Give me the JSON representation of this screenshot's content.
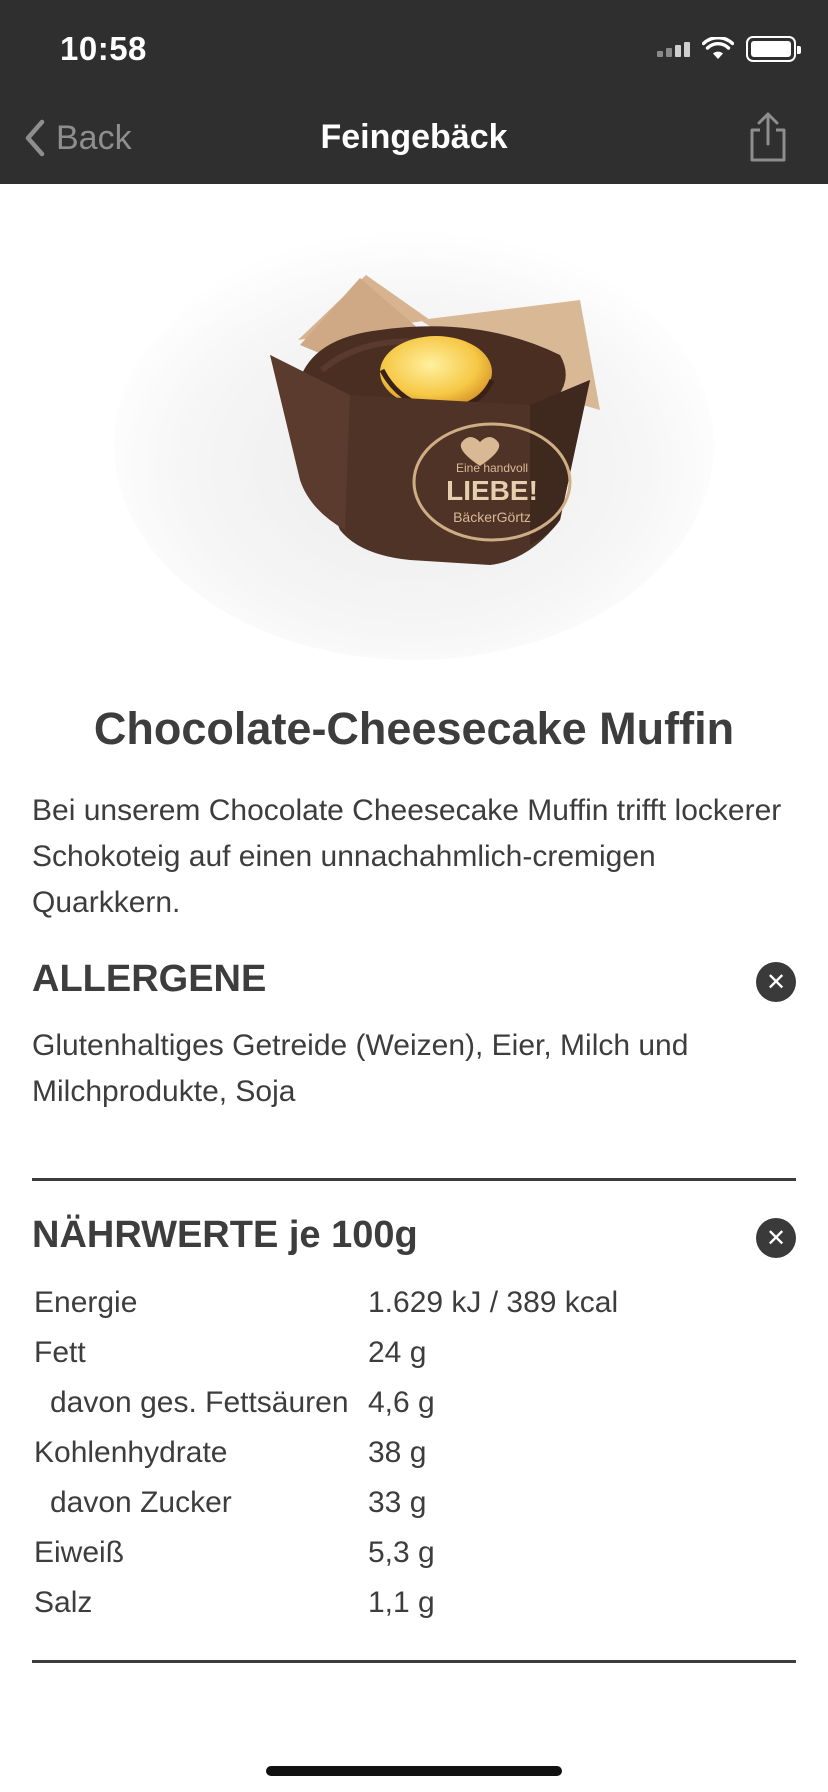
{
  "status_bar": {
    "time": "10:58"
  },
  "nav": {
    "back_label": "Back",
    "title": "Feingebäck"
  },
  "product": {
    "title": "Chocolate-Cheesecake Muffin",
    "description": "Bei unserem Chocolate Cheesecake Muffin trifft lockerer Schokoteig auf einen unnachahmlich-cremigen Quarkkern.",
    "wrapper_text": {
      "line1": "Eine handvoll",
      "line2": "LIEBE!",
      "line3": "BäckerGörtz"
    }
  },
  "allergens": {
    "heading": "ALLERGENE",
    "text": "Glutenhaltiges Getreide (Weizen), Eier, Milch und Milchprodukte, Soja"
  },
  "nutrition": {
    "heading": "NÄHRWERTE je 100g",
    "rows": [
      {
        "name": "Energie",
        "value": "1.629 kJ / 389 kcal"
      },
      {
        "name": "Fett",
        "value": "24 g"
      },
      {
        "name": "davon ges. Fettsäuren",
        "value": "4,6 g"
      },
      {
        "name": "Kohlenhydrate",
        "value": "38 g"
      },
      {
        "name": "davon Zucker",
        "value": "33 g"
      },
      {
        "name": "Eiweiß",
        "value": "5,3 g"
      },
      {
        "name": "Salz",
        "value": "1,1 g"
      }
    ]
  },
  "icons": {
    "back": "chevron-left-icon",
    "share": "share-icon",
    "close": "close-icon",
    "signal": "cellular-signal-icon",
    "wifi": "wifi-icon",
    "battery": "battery-icon"
  },
  "colors": {
    "top_bar": "#2f2f2f",
    "text": "#3d3d3d",
    "back_tint": "#8e8e8e",
    "close_badge": "#3a3a3a"
  }
}
